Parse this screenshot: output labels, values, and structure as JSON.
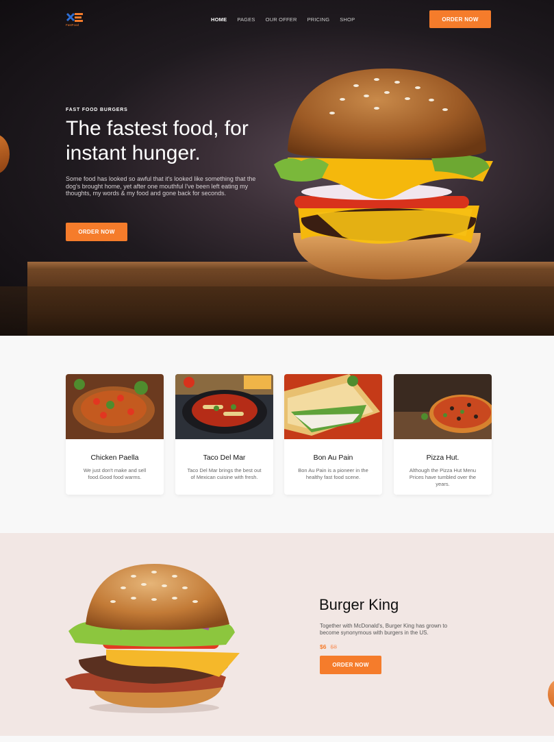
{
  "brand": {
    "logo_text": "FastFood",
    "accent": "#f57c2b"
  },
  "nav": {
    "items": [
      "HOME",
      "PAGES",
      "OUR OFFER",
      "PRICING",
      "SHOP"
    ],
    "active": "HOME"
  },
  "header": {
    "cta_label": "ORDER NOW"
  },
  "hero": {
    "kicker": "FAST FOOD BURGERS",
    "title": "The fastest food, for instant hunger.",
    "text": "Some food has looked so awful that it's looked like something that the dog's brought home, yet after one mouthful I've been left eating my thoughts, my words & my food and gone back for seconds.",
    "cta_label": "ORDER NOW"
  },
  "cards": [
    {
      "title": "Chicken Paella",
      "text": "We just don't make and sell food.Good food warms."
    },
    {
      "title": "Taco Del Mar",
      "text": "Taco Del Mar brings the best out of Mexican cuisine with fresh."
    },
    {
      "title": "Bon Au Pain",
      "text": "Bon Au Pain is a pioneer in the healthy fast food scene."
    },
    {
      "title": "Pizza Hut.",
      "text": "Although the Pizza Hut Menu Prices have tumbled over the years."
    }
  ],
  "feature": {
    "title": "Burger King",
    "text": "Together with McDonald's, Burger King has grown to become synonymous with burgers in the US.",
    "price": "$6",
    "old_price": "$8",
    "cta_label": "ORDER NOW"
  }
}
